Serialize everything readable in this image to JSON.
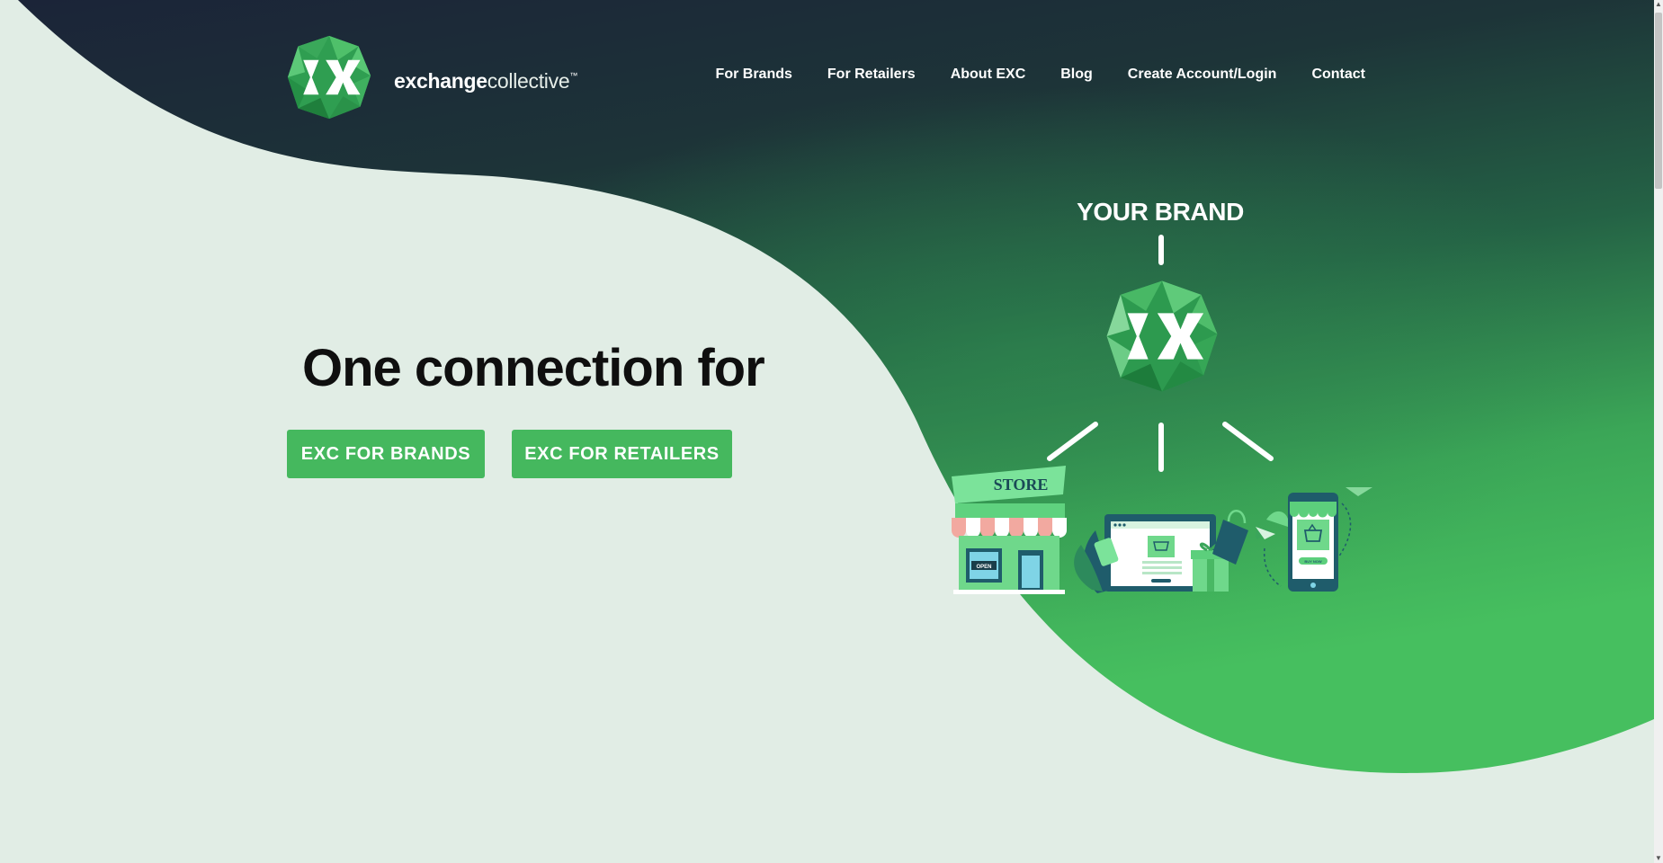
{
  "colors": {
    "navy": "#1b2438",
    "brand_green": "#45b85e",
    "mint_background": "#e1ede5",
    "heading_text": "#0f0f0f"
  },
  "logo": {
    "icon": "exc-logo-icon",
    "word_bold": "exchange",
    "word_regular": "collective",
    "trademark": "™"
  },
  "nav": {
    "items": [
      {
        "label": "For Brands"
      },
      {
        "label": "For Retailers"
      },
      {
        "label": "About EXC"
      },
      {
        "label": "Blog"
      },
      {
        "label": "Create Account/Login"
      },
      {
        "label": "Contact"
      }
    ]
  },
  "hero": {
    "title": "One connection for",
    "cta_brands": "EXC FOR BRANDS",
    "cta_retailers": "EXC FOR RETAILERS"
  },
  "illustration": {
    "heading": "YOUR BRAND",
    "store_sign": "STORE",
    "open_sign": "OPEN",
    "buy_now": "BUY NOW"
  }
}
